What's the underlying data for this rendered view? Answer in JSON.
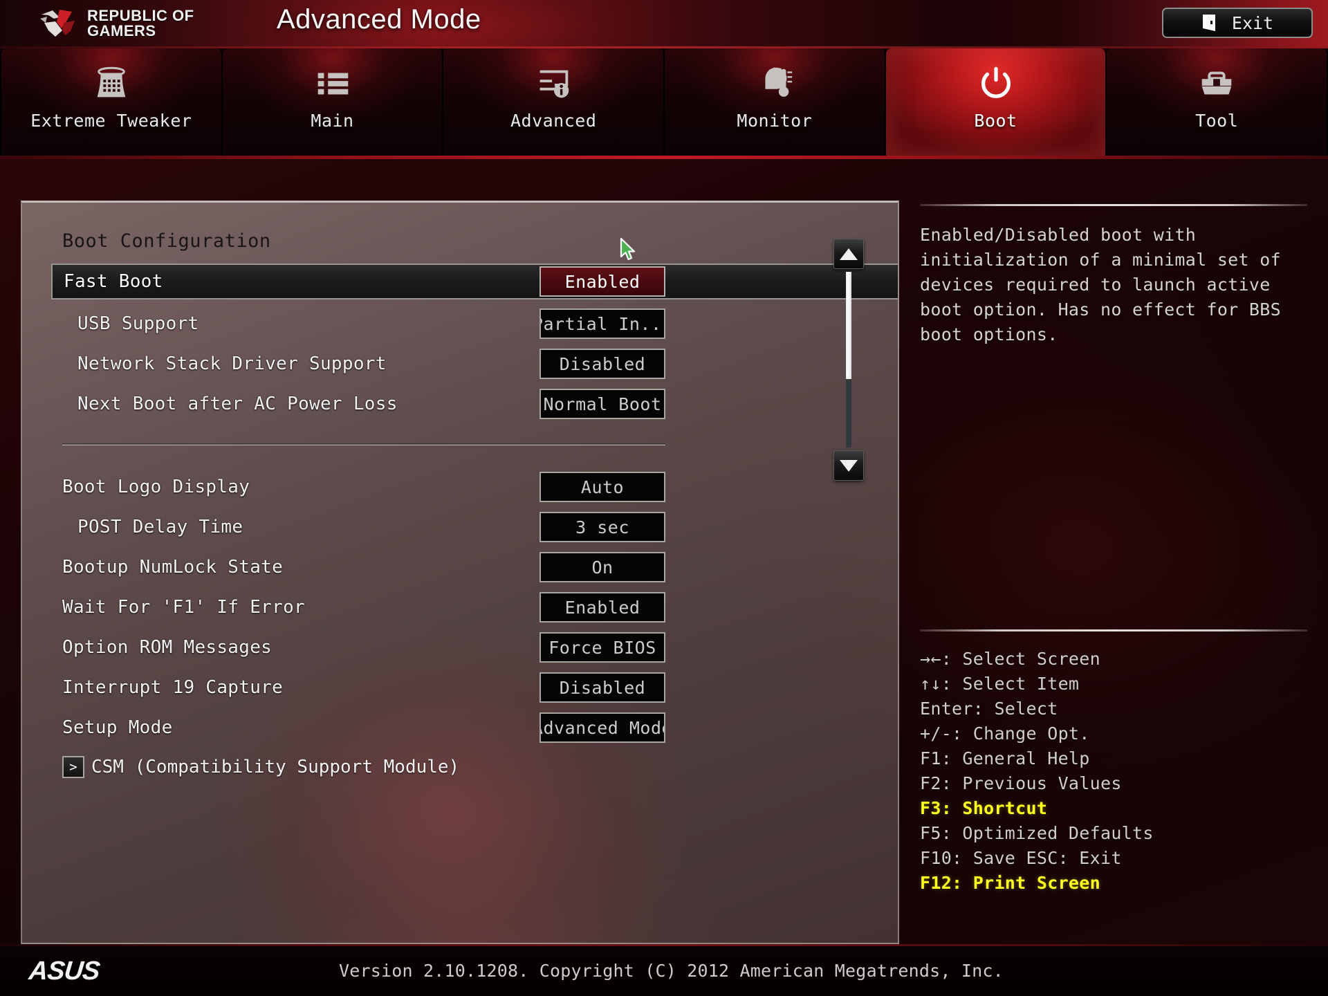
{
  "header": {
    "brand_line1": "REPUBLIC OF",
    "brand_line2": "GAMERS",
    "title": "Advanced Mode",
    "exit_label": "Exit",
    "exit_icon": "exit-door-icon",
    "accent_red": "#c01a22",
    "highlight_yellow": "#ffff22"
  },
  "nav": {
    "tabs": [
      {
        "label": "Extreme Tweaker",
        "icon": "overclock-tower-icon",
        "active": false
      },
      {
        "label": "Main",
        "icon": "list-icon",
        "active": false
      },
      {
        "label": "Advanced",
        "icon": "monitor-info-icon",
        "active": false
      },
      {
        "label": "Monitor",
        "icon": "gauge-thermometer-icon",
        "active": false
      },
      {
        "label": "Boot",
        "icon": "power-icon",
        "active": true
      },
      {
        "label": "Tool",
        "icon": "toolbox-icon",
        "active": false
      }
    ]
  },
  "main": {
    "section_title": "Boot Configuration",
    "rows": [
      {
        "label": "Fast Boot",
        "value": "Enabled",
        "indent": false,
        "selected": true
      },
      {
        "label": "USB Support",
        "value": "Partial In...",
        "indent": true,
        "selected": false
      },
      {
        "label": "Network Stack Driver Support",
        "value": "Disabled",
        "indent": true,
        "selected": false
      },
      {
        "label": "Next Boot after AC Power Loss",
        "value": "Normal Boot",
        "indent": true,
        "selected": false
      },
      {
        "label": "Boot Logo Display",
        "value": "Auto",
        "indent": false,
        "selected": false
      },
      {
        "label": "POST Delay Time",
        "value": "3 sec",
        "indent": true,
        "selected": false
      },
      {
        "label": "Bootup NumLock State",
        "value": "On",
        "indent": false,
        "selected": false
      },
      {
        "label": "Wait For 'F1' If Error",
        "value": "Enabled",
        "indent": false,
        "selected": false
      },
      {
        "label": "Option ROM Messages",
        "value": "Force BIOS",
        "indent": false,
        "selected": false
      },
      {
        "label": "Interrupt 19 Capture",
        "value": "Disabled",
        "indent": false,
        "selected": false
      },
      {
        "label": "Setup Mode",
        "value": "Advanced Mode",
        "indent": false,
        "selected": false
      }
    ],
    "submenu": {
      "label": "CSM (Compatibility Support Module)",
      "arrow": ">"
    }
  },
  "scrollbar": {
    "up_icon": "scroll-up-arrow-icon",
    "down_icon": "scroll-down-arrow-icon"
  },
  "help": {
    "text": "Enabled/Disabled boot with initialization of a minimal set of devices required to launch active boot option. Has no effect for BBS boot options."
  },
  "keys": {
    "lines": [
      {
        "text": "→←: Select Screen",
        "highlight": false
      },
      {
        "text": "↑↓: Select Item",
        "highlight": false
      },
      {
        "text": "Enter: Select",
        "highlight": false
      },
      {
        "text": "+/-: Change Opt.",
        "highlight": false
      },
      {
        "text": "F1: General Help",
        "highlight": false
      },
      {
        "text": "F2: Previous Values",
        "highlight": false
      },
      {
        "text": "F3: Shortcut",
        "highlight": true
      },
      {
        "text": "F5: Optimized Defaults",
        "highlight": false
      },
      {
        "text": "F10: Save  ESC: Exit",
        "highlight": false
      },
      {
        "text": "F12: Print Screen",
        "highlight": true
      }
    ]
  },
  "footer": {
    "logo": "ASUS",
    "version": "Version 2.10.1208. Copyright (C) 2012 American Megatrends, Inc."
  },
  "cursor": {
    "icon": "mouse-pointer-green-icon"
  }
}
